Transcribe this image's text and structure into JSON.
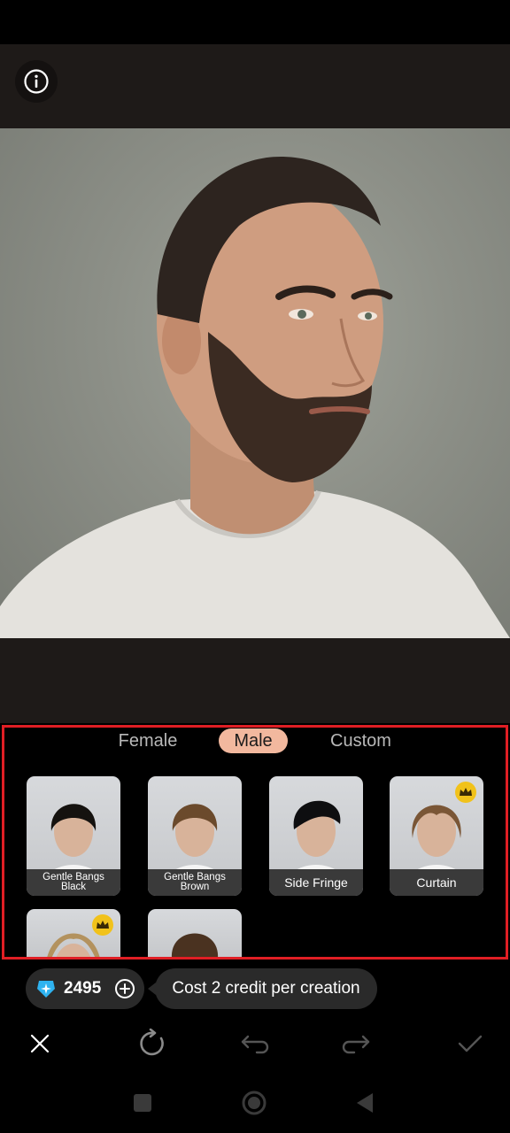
{
  "tabs": {
    "female": "Female",
    "male": "Male",
    "custom": "Custom",
    "selected": "Male"
  },
  "styles": [
    {
      "label": "Gentle Bangs Black",
      "premium": false,
      "hair_color": "#15120f"
    },
    {
      "label": "Gentle Bangs Brown",
      "premium": false,
      "hair_color": "#6b4a2c"
    },
    {
      "label": "Side Fringe",
      "premium": false,
      "hair_color": "#0e0e10"
    },
    {
      "label": "Curtain",
      "premium": true,
      "hair_color": "#7a5636"
    },
    {
      "label": "",
      "premium": true,
      "hair_color": "#b3925e"
    },
    {
      "label": "",
      "premium": false,
      "hair_color": "#4a3220"
    }
  ],
  "credits": {
    "count": "2495",
    "cost_text": "Cost 2 credit per creation"
  },
  "toolbar": {
    "icons": [
      "close-icon",
      "regenerate-icon",
      "undo-icon",
      "redo-icon",
      "confirm-icon"
    ]
  },
  "nav": {
    "icons": [
      "recents-icon",
      "home-icon",
      "back-icon"
    ]
  },
  "colors": {
    "accent_tab": "#f2b89e",
    "highlight_outline": "#e01e24",
    "crown": "#f1c21b",
    "gem": "#2fb3f0"
  }
}
